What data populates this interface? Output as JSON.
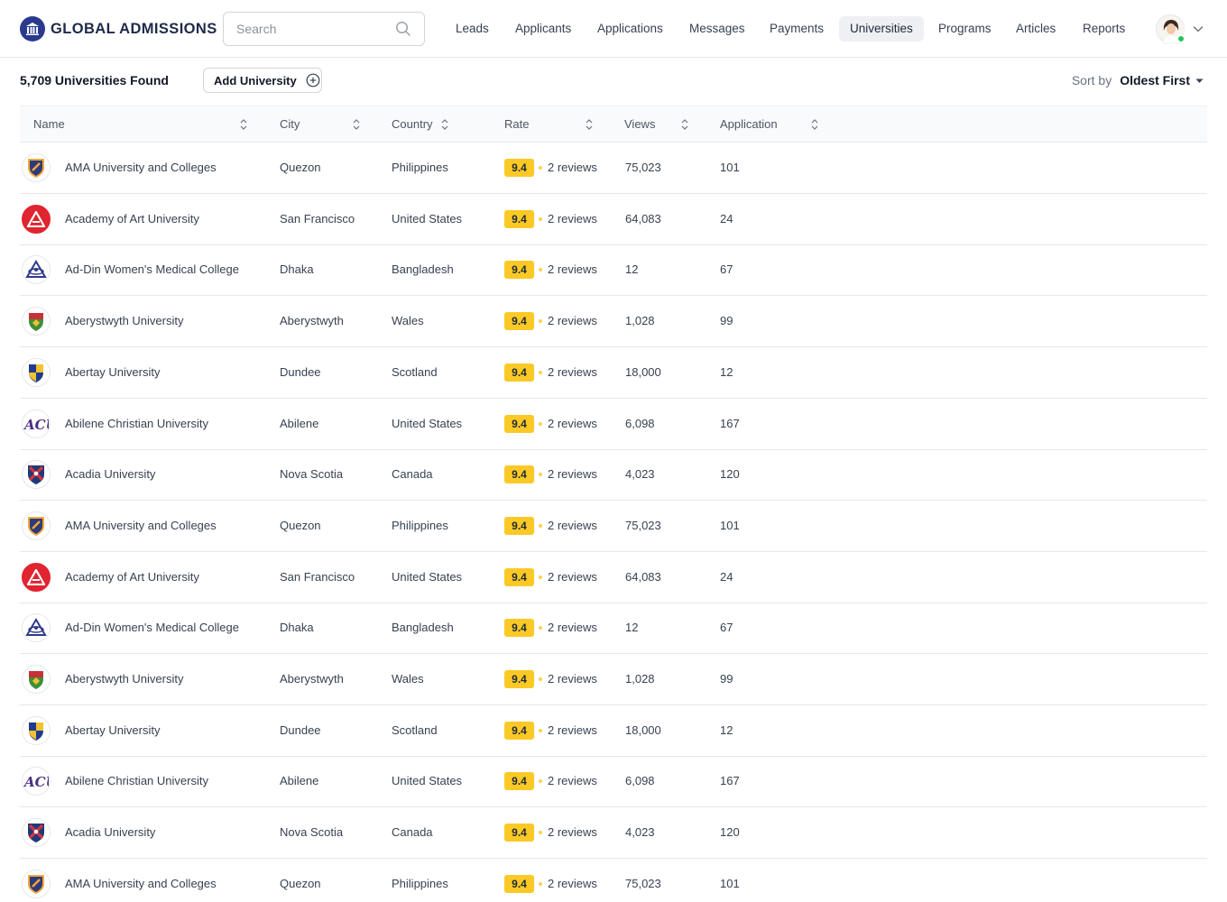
{
  "brand": {
    "name": "GLOBAL ADMISSIONS",
    "icon": "university-building-icon",
    "color": "#2b3a8f"
  },
  "search": {
    "placeholder": "Search",
    "value": ""
  },
  "nav": {
    "items": [
      {
        "label": "Leads",
        "active": false
      },
      {
        "label": "Applicants",
        "active": false
      },
      {
        "label": "Applications",
        "active": false
      },
      {
        "label": "Messages",
        "active": false
      },
      {
        "label": "Payments",
        "active": false
      },
      {
        "label": "Universities",
        "active": true
      },
      {
        "label": "Programs",
        "active": false
      },
      {
        "label": "Articles",
        "active": false
      },
      {
        "label": "Reports",
        "active": false
      }
    ]
  },
  "user": {
    "online": true,
    "status_color": "#22c55e"
  },
  "toolbar": {
    "found_text": "5,709 Universities Found",
    "add_label": "Add University",
    "sort_label": "Sort by",
    "sort_value": "Oldest First"
  },
  "table": {
    "columns": [
      "Name",
      "City",
      "Country",
      "Rate",
      "Views",
      "Application"
    ],
    "rows": [
      {
        "logo": "shield-crest-icon",
        "name": "AMA University and Colleges",
        "city": "Quezon",
        "country": "Philippines",
        "rate": "9.4",
        "reviews": "2 reviews",
        "views": "75,023",
        "applications": "101"
      },
      {
        "logo": "triangle-a-icon",
        "name": "Academy of Art University",
        "city": "San Francisco",
        "country": "United States",
        "rate": "9.4",
        "reviews": "2 reviews",
        "views": "64,083",
        "applications": "24"
      },
      {
        "logo": "triangle-emblem-icon",
        "name": "Ad-Din Women's Medical College",
        "city": "Dhaka",
        "country": "Bangladesh",
        "rate": "9.4",
        "reviews": "2 reviews",
        "views": "12",
        "applications": "67"
      },
      {
        "logo": "crest-green-icon",
        "name": "Aberystwyth University",
        "city": "Aberystwyth",
        "country": "Wales",
        "rate": "9.4",
        "reviews": "2 reviews",
        "views": "1,028",
        "applications": "99"
      },
      {
        "logo": "crest-blue-yellow-icon",
        "name": "Abertay University",
        "city": "Dundee",
        "country": "Scotland",
        "rate": "9.4",
        "reviews": "2 reviews",
        "views": "18,000",
        "applications": "12"
      },
      {
        "logo": "acu-monogram-icon",
        "name": "Abilene Christian University",
        "city": "Abilene",
        "country": "United States",
        "rate": "9.4",
        "reviews": "2 reviews",
        "views": "6,098",
        "applications": "167"
      },
      {
        "logo": "shield-red-blue-icon",
        "name": "Acadia University",
        "city": "Nova Scotia",
        "country": "Canada",
        "rate": "9.4",
        "reviews": "2 reviews",
        "views": "4,023",
        "applications": "120"
      },
      {
        "logo": "shield-crest-icon",
        "name": "AMA University and Colleges",
        "city": "Quezon",
        "country": "Philippines",
        "rate": "9.4",
        "reviews": "2 reviews",
        "views": "75,023",
        "applications": "101"
      },
      {
        "logo": "triangle-a-icon",
        "name": "Academy of Art University",
        "city": "San Francisco",
        "country": "United States",
        "rate": "9.4",
        "reviews": "2 reviews",
        "views": "64,083",
        "applications": "24"
      },
      {
        "logo": "triangle-emblem-icon",
        "name": "Ad-Din Women's Medical College",
        "city": "Dhaka",
        "country": "Bangladesh",
        "rate": "9.4",
        "reviews": "2 reviews",
        "views": "12",
        "applications": "67"
      },
      {
        "logo": "crest-green-icon",
        "name": "Aberystwyth University",
        "city": "Aberystwyth",
        "country": "Wales",
        "rate": "9.4",
        "reviews": "2 reviews",
        "views": "1,028",
        "applications": "99"
      },
      {
        "logo": "crest-blue-yellow-icon",
        "name": "Abertay University",
        "city": "Dundee",
        "country": "Scotland",
        "rate": "9.4",
        "reviews": "2 reviews",
        "views": "18,000",
        "applications": "12"
      },
      {
        "logo": "acu-monogram-icon",
        "name": "Abilene Christian University",
        "city": "Abilene",
        "country": "United States",
        "rate": "9.4",
        "reviews": "2 reviews",
        "views": "6,098",
        "applications": "167"
      },
      {
        "logo": "shield-red-blue-icon",
        "name": "Acadia University",
        "city": "Nova Scotia",
        "country": "Canada",
        "rate": "9.4",
        "reviews": "2 reviews",
        "views": "4,023",
        "applications": "120"
      },
      {
        "logo": "shield-crest-icon",
        "name": "AMA University and Colleges",
        "city": "Quezon",
        "country": "Philippines",
        "rate": "9.4",
        "reviews": "2 reviews",
        "views": "75,023",
        "applications": "101"
      }
    ]
  },
  "colors": {
    "rate_badge": "#fbc926",
    "active_nav_bg": "#eef0f4",
    "border": "#e5e7eb"
  }
}
